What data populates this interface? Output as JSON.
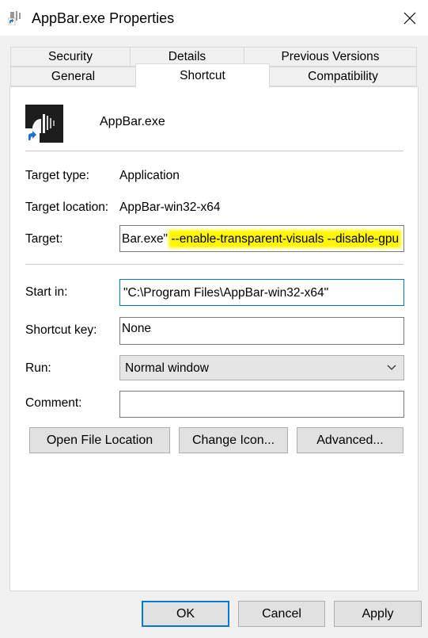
{
  "window": {
    "title": "AppBar.exe Properties",
    "close_glyph": "✕"
  },
  "tabs": {
    "row1": [
      "Security",
      "Details",
      "Previous Versions"
    ],
    "row2": [
      "General",
      "Shortcut",
      "Compatibility"
    ],
    "active": "Shortcut"
  },
  "header": {
    "exe_name": "AppBar.exe",
    "icon": "appbar-shortcut-icon"
  },
  "fields": {
    "target_type_label": "Target type:",
    "target_type_value": "Application",
    "target_location_label": "Target location:",
    "target_location_value": "AppBar-win32-x64",
    "target_label": "Target:",
    "target_value_start": "Bar.exe\" ",
    "target_value_highlighted": "--enable-transparent-visuals --disable-gpu",
    "start_in_label": "Start in:",
    "start_in_value": "\"C:\\Program Files\\AppBar-win32-x64\"",
    "shortcut_key_label": "Shortcut key:",
    "shortcut_key_value": "None",
    "run_label": "Run:",
    "run_value": "Normal window",
    "comment_label": "Comment:",
    "comment_value": ""
  },
  "action_buttons": [
    "Open File Location",
    "Change Icon...",
    "Advanced..."
  ],
  "dialog_buttons": {
    "ok": "OK",
    "cancel": "Cancel",
    "apply": "Apply"
  },
  "colors": {
    "accent": "#0078d7",
    "highlight": "#fff600",
    "icon_bg": "#1d1d1d"
  }
}
